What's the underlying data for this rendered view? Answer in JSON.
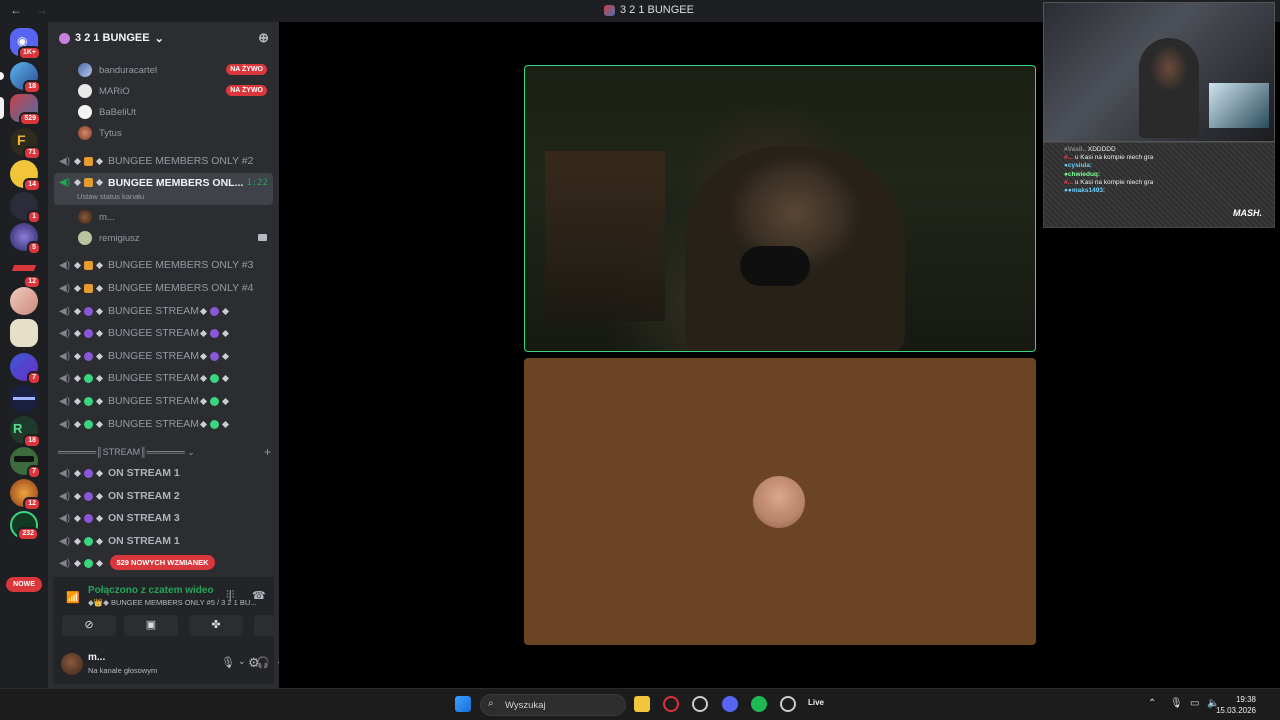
{
  "window": {
    "back": "←",
    "forward": "→",
    "title": "3 2 1 BUNGEE"
  },
  "guilds": [
    {
      "badge": "1K+"
    },
    {
      "badge": "18"
    },
    {
      "badge": "529"
    },
    {
      "badge": "71"
    },
    {
      "badge": "14"
    },
    {
      "badge": "1"
    },
    {
      "badge": "5"
    },
    {
      "badge": "12"
    },
    {
      "badge": ""
    },
    {
      "badge": ""
    },
    {
      "badge": "7"
    },
    {
      "badge": ""
    },
    {
      "badge": "18"
    },
    {
      "badge": "7"
    },
    {
      "badge": "12"
    },
    {
      "badge": "232"
    }
  ],
  "new_label": "NOWE",
  "server": {
    "name": "3 2 1 BUNGEE",
    "chevron": "⌄",
    "add_user_icon": "person-add-icon"
  },
  "top_users": [
    {
      "name": "banduracartel",
      "live": "NA ŻYWO"
    },
    {
      "name": "MARiO",
      "live": "NA ŻYWO"
    },
    {
      "name": "BaBeliUt",
      "live": ""
    },
    {
      "name": "Tytus",
      "live": ""
    }
  ],
  "channels": {
    "members2": "BUNGEE MEMBERS ONLY #2",
    "members_active": "BUNGEE MEMBERS ONL...",
    "members_active_time": "1:22",
    "members_active_sub": "Ustaw status kanału",
    "active_users": [
      "m...",
      "remigiusz"
    ],
    "members3": "BUNGEE MEMBERS ONLY #3",
    "members4": "BUNGEE MEMBERS ONLY #4",
    "stream": "BUNGEE STREAM",
    "category": "══════║STREAM║══════",
    "on_stream_1": "ON STREAM 1",
    "on_stream_2": "ON STREAM 2",
    "on_stream_3": "ON STREAM 3",
    "on_stream_1b": "ON STREAM 1"
  },
  "mentions": "529 NOWYCH WZMIANEK",
  "voice": {
    "status": "Połączono z czatem wideo",
    "channel": "◆👑◆ BUNGEE MEMBERS ONLY #5 / 3 2 1 BU..."
  },
  "user": {
    "name": "m...",
    "status": "Na kanale głosowym"
  },
  "chat": [
    {
      "name": "#Vasli..",
      "msg": "XDDDDD"
    },
    {
      "name": "#...",
      "msg": "u Kasi na kompie niech gra"
    },
    {
      "name": "●cysiula:",
      "msg": ""
    },
    {
      "name": "●chwieduq:",
      "msg": ""
    },
    {
      "name": "#...",
      "msg": "u Kasi na kompie niech gra"
    },
    {
      "name": "●●maks1493:",
      "msg": ""
    }
  ],
  "chat_brand": "MASH.",
  "taskbar": {
    "search": "Wyszukaj",
    "live": "Live",
    "time": "19:38",
    "date": "15.03.2026"
  }
}
